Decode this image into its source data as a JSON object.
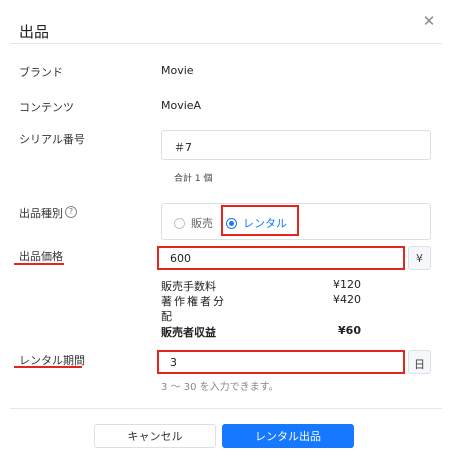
{
  "dialog": {
    "title": "出品",
    "close_icon": "close-icon"
  },
  "fields": {
    "brand_label": "ブランド",
    "brand_value": "Movie",
    "contents_label": "コンテンツ",
    "contents_value": "MovieA",
    "serial_label": "シリアル番号",
    "serial_value": "＃7",
    "serial_total": "合計 1 個",
    "type_label": "出品種別",
    "type_help_icon": "question-icon",
    "type_options": [
      {
        "label": "販売",
        "selected": false
      },
      {
        "label": "レンタル",
        "selected": true
      }
    ],
    "price_label": "出品価格",
    "price_value": "600",
    "price_unit": "¥",
    "fee_label": "販売手数料",
    "fee_amount": "¥120",
    "royalty_label_line1": "著作権者分",
    "royalty_label_line2": "配",
    "royalty_amount": "¥420",
    "proceeds_label": "販売者収益",
    "proceeds_amount": "¥60",
    "period_label": "レンタル期間",
    "period_value": "3",
    "period_unit": "日",
    "period_hint": "3 ～ 30 を入力できます。"
  },
  "footer": {
    "cancel_label": "キャンセル",
    "submit_label": "レンタル出品"
  },
  "colors": {
    "primary": "#1677ff",
    "annotation_red": "#e3251b"
  }
}
